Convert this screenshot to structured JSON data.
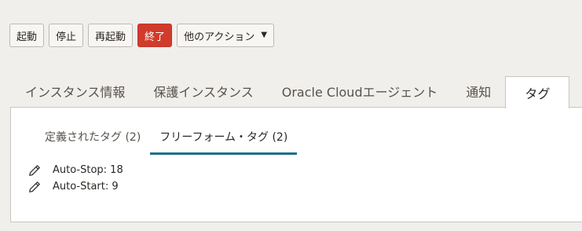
{
  "toolbar": {
    "start_label": "起動",
    "stop_label": "停止",
    "reboot_label": "再起動",
    "terminate_label": "終了",
    "more_actions_label": "他のアクション",
    "more_actions_icon": "chevron-down-icon",
    "terminate_color": "#d13b2c"
  },
  "tabs": [
    {
      "label": "インスタンス情報"
    },
    {
      "label": "保護インスタンス"
    },
    {
      "label": "Oracle Cloudエージェント"
    },
    {
      "label": "通知"
    },
    {
      "label": "タグ",
      "active": true
    }
  ],
  "tags_panel": {
    "subtabs": [
      {
        "label": "定義されたタグ (2)"
      },
      {
        "label": "フリーフォーム・タグ (2)",
        "active": true
      }
    ],
    "accent_color": "#1d6f8a",
    "tags": [
      {
        "text": "Auto-Stop: 18",
        "icon": "pencil-icon"
      },
      {
        "text": "Auto-Start: 9",
        "icon": "pencil-icon"
      }
    ]
  }
}
